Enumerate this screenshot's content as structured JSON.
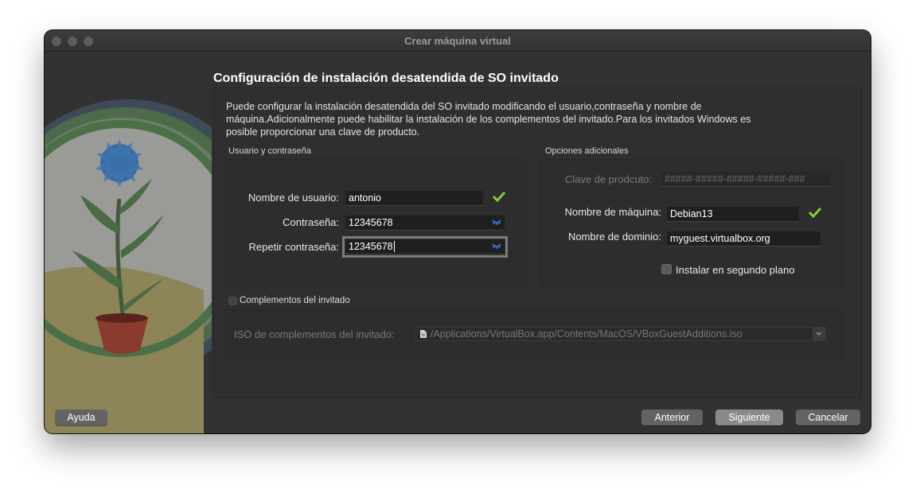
{
  "window": {
    "title": "Crear máquina virtual"
  },
  "page": {
    "heading": "Configuración de instalación desatendida de SO invitado",
    "description": "Puede configurar la instalación desatendida del SO invitado modificando el usuario,contraseña y nombre de máquina.Adicionalmente puede habilitar la instalación de los complementos del invitado.Para los invitados Windows es posible proporcionar una clave de producto."
  },
  "user_group": {
    "title": "Usuario y contraseña",
    "username_label": "Nombre de usuario:",
    "username_value": "antonio",
    "password_label": "Contraseña:",
    "password_value": "12345678",
    "repeat_label": "Repetir contraseña:",
    "repeat_value": "12345678"
  },
  "options_group": {
    "title": "Opciones adicionales",
    "product_key_label": "Clave de prodcuto:",
    "product_key_value": "#####-#####-#####-#####-###",
    "hostname_label": "Nombre de máquina:",
    "hostname_value": "Debian13",
    "domain_label": "Nombre de dominio:",
    "domain_value": "myguest.virtualbox.org",
    "background_label": "Instalar en segundo plano"
  },
  "additions": {
    "checkbox_label": "Complementos del invitado",
    "iso_label": "ISO de complementos del invitado:",
    "iso_path": "/Applications/VirtualBox.app/Contents/MacOS/VBoxGuestAdditions.iso"
  },
  "buttons": {
    "help": "Ayuda",
    "back": "Anterior",
    "next": "Siguiente",
    "cancel": "Cancelar"
  },
  "colors": {
    "window_bg": "#323232",
    "valid_check": "#7dd13b",
    "eye_icon": "#3b82f6"
  },
  "icons": [
    "check-icon",
    "eye-icon",
    "document-icon",
    "chevron-down-icon"
  ]
}
